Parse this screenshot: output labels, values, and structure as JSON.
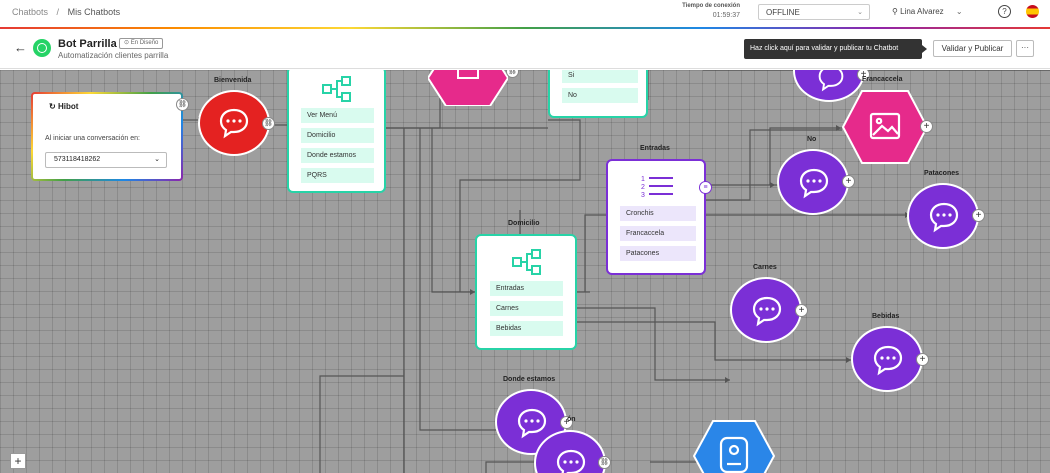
{
  "breadcrumb": {
    "root": "Chatbots",
    "separator": "/",
    "current": "Mis Chatbots"
  },
  "connection": {
    "label": "Tiempo de conexión",
    "time": "01:59:37"
  },
  "status": {
    "value": "OFFLINE"
  },
  "user": {
    "name": "Lina Alvarez"
  },
  "header": {
    "bot_name": "Bot Parrilla",
    "badge": "En Diseño",
    "subtitle": "Automatización clientes parrilla",
    "tooltip": "Haz click aquí para validar y publicar tu Chatbot",
    "publish_label": "Validar y Publicar",
    "more_label": "···"
  },
  "hibot": {
    "title": "Hibot",
    "label": "Al iniciar una conversación en:",
    "phone": "573118418262"
  },
  "nodes": {
    "bienvenida": "Bienvenida",
    "menu_options": [
      "Ver Menú",
      "Domicilio",
      "Donde estamos",
      "PQRS"
    ],
    "yesno_options": [
      "Si",
      "No"
    ],
    "entradas": {
      "title": "Entradas",
      "options": [
        "Cronchis",
        "Francaccela",
        "Patacones"
      ]
    },
    "domicilio": {
      "title": "Domicilio",
      "options": [
        "Entradas",
        "Carnes",
        "Bebidas"
      ]
    },
    "francaccela": "Francaccela",
    "no": "No",
    "patacones": "Patacones",
    "carnes": "Carnes",
    "bebidas": "Bebidas",
    "donde_estamos": "Donde estamos",
    "partial_title": "ón"
  },
  "colors": {
    "purple": "#7b2fd6",
    "red": "#e42221",
    "pink": "#e62a8b",
    "teal": "#27d3a7",
    "blue": "#2a86e8"
  },
  "icons": [
    "chat-bubble-icon",
    "flow-icon",
    "list-icon",
    "image-icon",
    "person-icon",
    "link-icon",
    "plus-icon",
    "whatsapp-icon",
    "help-icon",
    "user-icon"
  ]
}
